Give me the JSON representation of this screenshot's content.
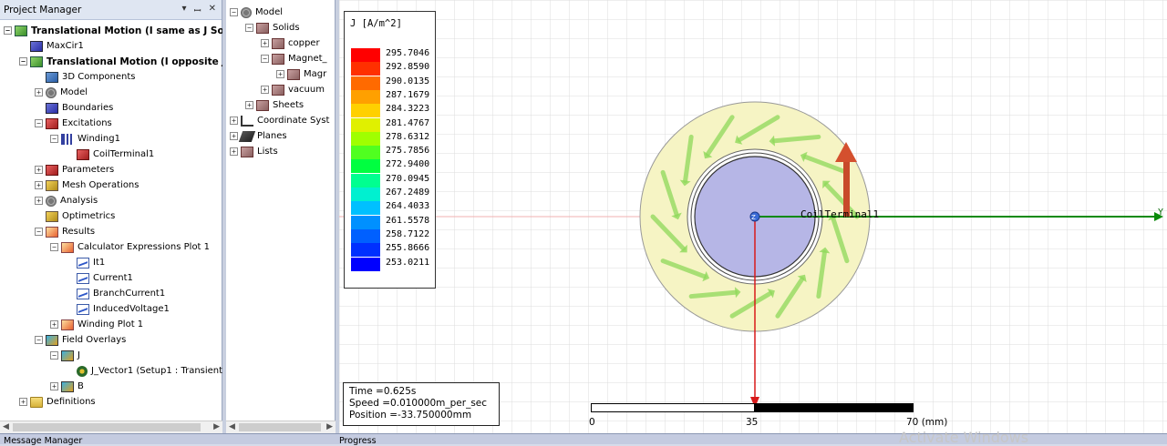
{
  "project_manager": {
    "title": "Project Manager",
    "controls": [
      "▾",
      "ꟷ",
      "✕"
    ],
    "items": [
      {
        "label": "Translational Motion (I same as J Sout",
        "icon": "project-icon",
        "indent": 0,
        "expander": "−",
        "bold": true
      },
      {
        "label": "MaxCir1",
        "icon": "circuit-icon",
        "indent": 1,
        "expander": ""
      },
      {
        "label": "Translational Motion (I opposite J)",
        "icon": "design-icon",
        "indent": 1,
        "expander": "−",
        "bold": true
      },
      {
        "label": "3D Components",
        "icon": "components-icon",
        "indent": 2,
        "expander": ""
      },
      {
        "label": "Model",
        "icon": "model-icon",
        "indent": 2,
        "expander": "+"
      },
      {
        "label": "Boundaries",
        "icon": "boundaries-icon",
        "indent": 2,
        "expander": ""
      },
      {
        "label": "Excitations",
        "icon": "excitations-icon",
        "indent": 2,
        "expander": "−"
      },
      {
        "label": "Winding1",
        "icon": "winding-icon",
        "indent": 3,
        "expander": "−"
      },
      {
        "label": "CoilTerminal1",
        "icon": "coil-terminal-icon",
        "indent": 4,
        "expander": ""
      },
      {
        "label": "Parameters",
        "icon": "parameters-icon",
        "indent": 2,
        "expander": "+"
      },
      {
        "label": "Mesh Operations",
        "icon": "mesh-icon",
        "indent": 2,
        "expander": "+"
      },
      {
        "label": "Analysis",
        "icon": "analysis-icon",
        "indent": 2,
        "expander": "+"
      },
      {
        "label": "Optimetrics",
        "icon": "optimetrics-icon",
        "indent": 2,
        "expander": ""
      },
      {
        "label": "Results",
        "icon": "results-icon",
        "indent": 2,
        "expander": "−"
      },
      {
        "label": "Calculator Expressions Plot 1",
        "icon": "plot-icon",
        "indent": 3,
        "expander": "−"
      },
      {
        "label": "It1",
        "icon": "trace-icon",
        "indent": 4,
        "expander": ""
      },
      {
        "label": "Current1",
        "icon": "trace-icon",
        "indent": 4,
        "expander": ""
      },
      {
        "label": "BranchCurrent1",
        "icon": "trace-icon",
        "indent": 4,
        "expander": ""
      },
      {
        "label": "InducedVoltage1",
        "icon": "trace-icon",
        "indent": 4,
        "expander": ""
      },
      {
        "label": "Winding Plot 1",
        "icon": "plot-icon",
        "indent": 3,
        "expander": "+"
      },
      {
        "label": "Field Overlays",
        "icon": "field-overlays-icon",
        "indent": 2,
        "expander": "−"
      },
      {
        "label": "J",
        "icon": "field-icon",
        "indent": 3,
        "expander": "−"
      },
      {
        "label": "J_Vector1 (Setup1 : Transient",
        "icon": "vector-icon",
        "indent": 4,
        "expander": ""
      },
      {
        "label": "B",
        "icon": "field-icon",
        "indent": 3,
        "expander": "+"
      },
      {
        "label": "Definitions",
        "icon": "folder-icon",
        "indent": 1,
        "expander": "+"
      }
    ]
  },
  "model_tree": {
    "items": [
      {
        "label": "Model",
        "icon": "model-icon",
        "indent": 0,
        "expander": "−"
      },
      {
        "label": "Solids",
        "icon": "solids-icon",
        "indent": 1,
        "expander": "−"
      },
      {
        "label": "copper",
        "icon": "copper-icon",
        "indent": 2,
        "expander": "+"
      },
      {
        "label": "Magnet_",
        "icon": "magnet-icon",
        "indent": 2,
        "expander": "−"
      },
      {
        "label": "Magr",
        "icon": "magnet-part-icon",
        "indent": 3,
        "expander": "+"
      },
      {
        "label": "vacuum",
        "icon": "vacuum-icon",
        "indent": 2,
        "expander": "+"
      },
      {
        "label": "Sheets",
        "icon": "sheets-icon",
        "indent": 1,
        "expander": "+"
      },
      {
        "label": "Coordinate Syst",
        "icon": "axes-icon",
        "indent": 0,
        "expander": "+"
      },
      {
        "label": "Planes",
        "icon": "planes-icon",
        "indent": 0,
        "expander": "+"
      },
      {
        "label": "Lists",
        "icon": "lists-icon",
        "indent": 0,
        "expander": "+"
      }
    ]
  },
  "legend": {
    "title": "J [A/m^2]",
    "values": [
      "295.7046",
      "292.8590",
      "290.0135",
      "287.1679",
      "284.3223",
      "281.4767",
      "278.6312",
      "275.7856",
      "272.9400",
      "270.0945",
      "267.2489",
      "264.4033",
      "261.5578",
      "258.7122",
      "255.8666",
      "253.0211"
    ],
    "colors": [
      "#ff0000",
      "#ff3000",
      "#ff6a00",
      "#ffa000",
      "#ffd000",
      "#e0f000",
      "#a0ff00",
      "#50ff20",
      "#00ff40",
      "#00ff90",
      "#00f0d0",
      "#00c0ff",
      "#0090ff",
      "#0060ff",
      "#0030ff",
      "#0000ff"
    ]
  },
  "viewport": {
    "terminal_label": "CoilTerminal1",
    "axis_y_label": "Y",
    "axis_z_label": "Z"
  },
  "info": {
    "time": "Time    =0.625s",
    "speed": "Speed   =0.010000m_per_sec",
    "position": "Position =-33.750000mm"
  },
  "scale": {
    "labels": [
      "0",
      "35",
      "70 (mm)"
    ]
  },
  "bottom": {
    "left_label": "Message Manager",
    "right_label": "Progress",
    "watermark": "Activate Windows"
  },
  "colors": {
    "ring_fill": "#f6f4c4",
    "core_fill": "#b6b6e6",
    "y_axis": "#0a8a0a",
    "z_axis": "#d81a1a",
    "arrow_green": "#8ed85a"
  }
}
